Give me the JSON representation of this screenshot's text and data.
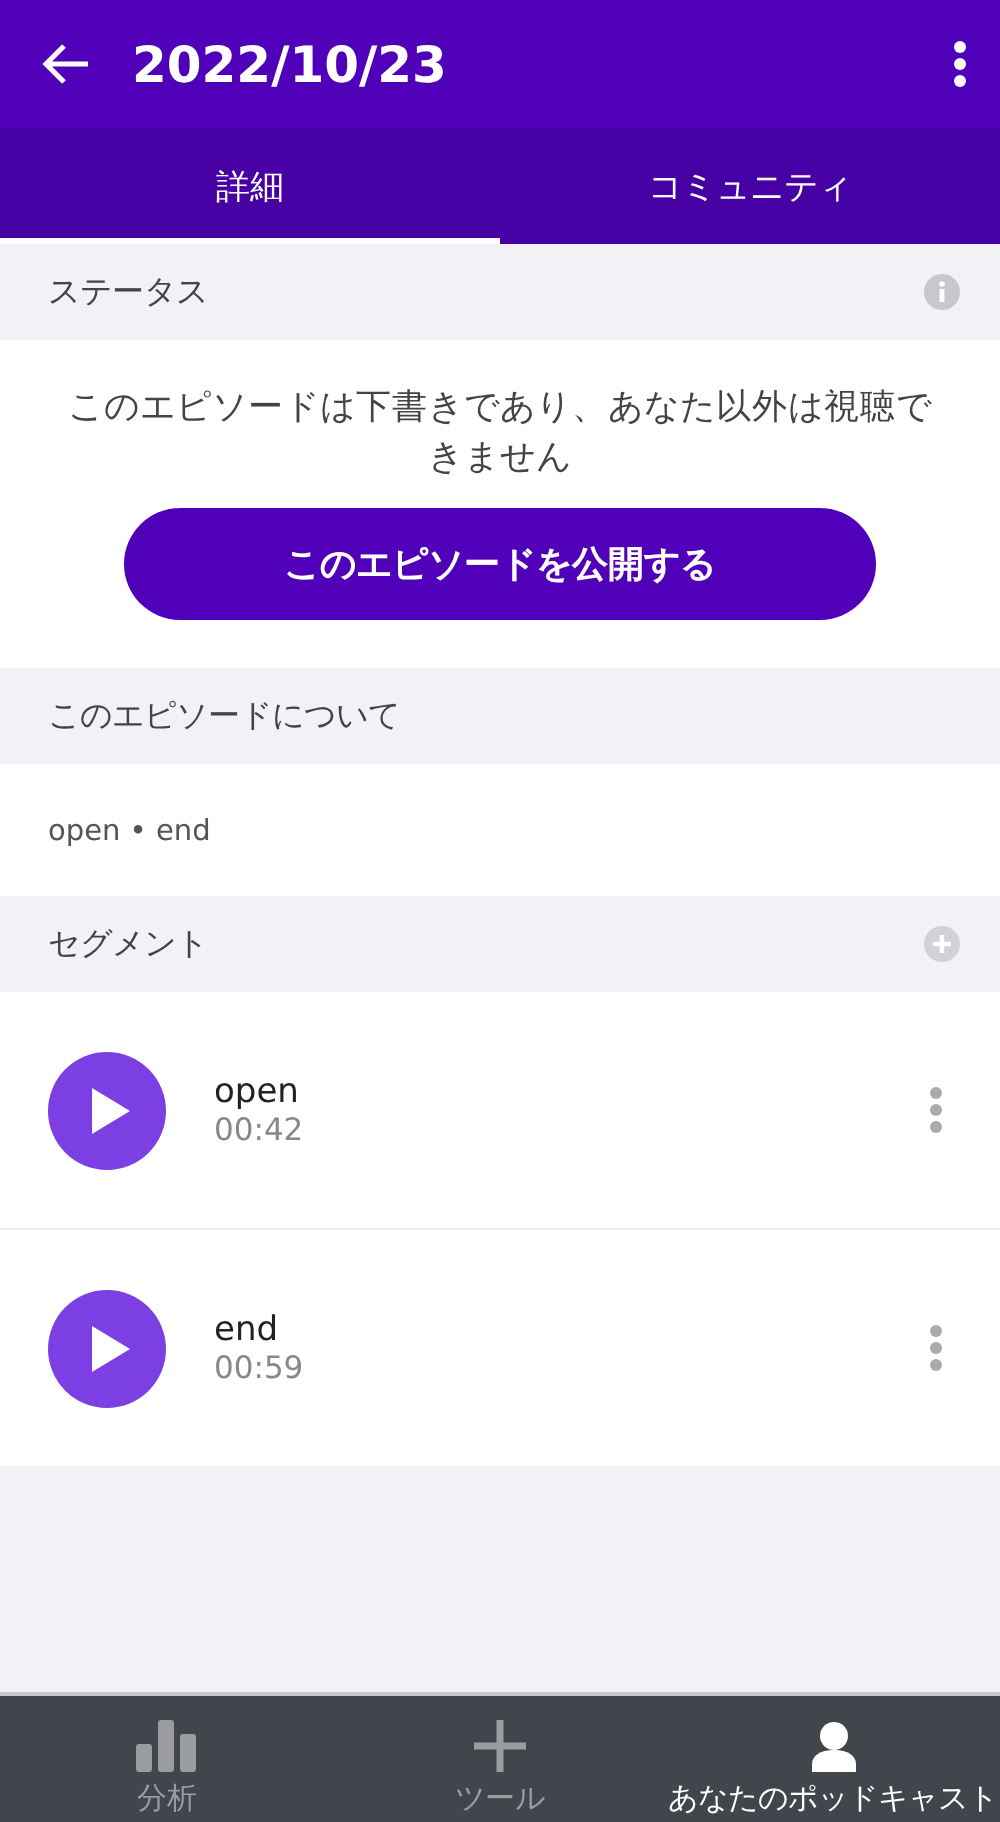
{
  "header": {
    "title": "2022/10/23"
  },
  "tabs": [
    {
      "label": "詳細",
      "selected": true
    },
    {
      "label": "コミュニティ",
      "selected": false
    }
  ],
  "sections": [
    {
      "kind": "status",
      "title": "ステータス",
      "message": "このエピソードは下書きであり、あなた以外は視聴できません",
      "button": "このエピソードを公開する"
    },
    {
      "kind": "about",
      "title": "このエピソードについて",
      "text": "open • end"
    },
    {
      "kind": "segments",
      "title": "セグメント",
      "segments": [
        {
          "name": "open",
          "duration": "00:42"
        },
        {
          "name": "end",
          "duration": "00:59"
        }
      ]
    }
  ],
  "bottom_nav": [
    {
      "kind": "analytics",
      "label": "分析",
      "selected": false
    },
    {
      "kind": "tools",
      "label": "ツール",
      "selected": false
    },
    {
      "kind": "podcast",
      "label": "あなたのポッドキャスト",
      "selected": true
    }
  ]
}
